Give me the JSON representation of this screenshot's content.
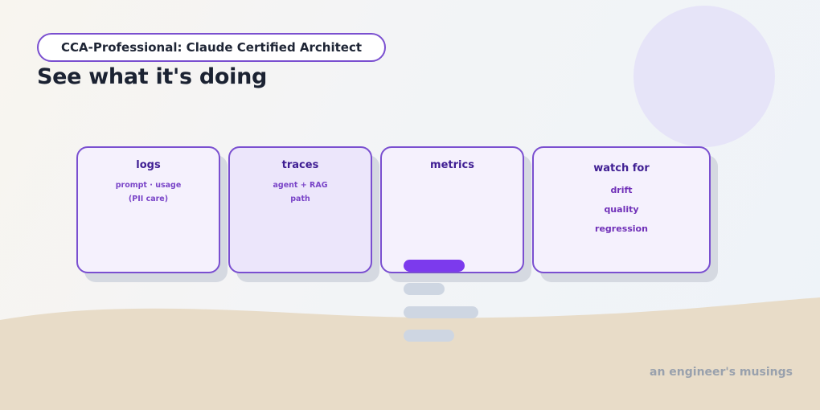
{
  "badge": {
    "label": "CCA-Professional: Claude Certified Architect"
  },
  "heading": "See what it's doing",
  "cards": {
    "logs": {
      "title": "logs",
      "lines": [
        "prompt · usage",
        "(PII care)"
      ]
    },
    "traces": {
      "title": "traces",
      "lines": [
        "agent + RAG",
        "path"
      ]
    },
    "metrics": {
      "title": "metrics"
    },
    "watch": {
      "title": "watch for",
      "items": [
        "drift",
        "quality",
        "regression"
      ]
    }
  },
  "footer": "an engineer's musings",
  "colors": {
    "accent": "#7a4fd0",
    "active_bar": "#7c3aed",
    "card_fill": "#f5f1fd",
    "sand": "#e8dcc8",
    "circle": "#e6e4f8"
  }
}
